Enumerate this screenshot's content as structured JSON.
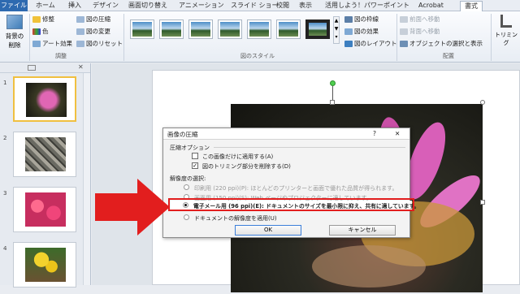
{
  "tabs": [
    "ファイル",
    "ホーム",
    "挿入",
    "デザイン",
    "画面切り替え",
    "アニメーション",
    "スライド ショー",
    "校閲",
    "表示",
    "活用しよう！パワーポイント",
    "Acrobat",
    "書式"
  ],
  "ribbon": {
    "remove_bg": [
      "背景の",
      "削除"
    ],
    "adjust": [
      "修整",
      "色",
      "アート効果"
    ],
    "adjust_right": [
      "図の圧縮",
      "図の変更",
      "図のリセット"
    ],
    "group_adjust": "調整",
    "style_right": [
      "図の枠線",
      "図の効果",
      "図のレイアウト"
    ],
    "group_styles": "図のスタイル",
    "arrange": [
      "前面へ移動",
      "背面へ移動",
      "オブジェクトの選択と表示"
    ],
    "group_arrange": "配置",
    "crop": "トリミング"
  },
  "slides": [
    "1",
    "2",
    "3",
    "4"
  ],
  "dialog": {
    "title": "画像の圧縮",
    "help": "?",
    "close": "✕",
    "compress_options": "圧縮オプション",
    "only_this": "この画像だけに適用する(A)",
    "delete_cropped": "図のトリミング部分を削除する(D)",
    "resolution": "解像度の選択:",
    "opt_print": "印刷用 (220 ppi)(P): ほとんどのプリンターと画面で優れた品質が得られます。",
    "opt_screen": "画面用 (150 ppi)(S): Web ページやプロジェクターに適しています。",
    "opt_email": "電子メール用 (96 ppi)(E): ドキュメントのサイズを最小限に抑え、共有に適しています。",
    "opt_doc": "ドキュメントの解像度を適用(U)",
    "ok": "OK",
    "cancel": "キャンセル"
  },
  "colors": {
    "highlight": "#e21e1e",
    "arrow": "#e21e1e",
    "file_tab": "#2e6ab0"
  }
}
